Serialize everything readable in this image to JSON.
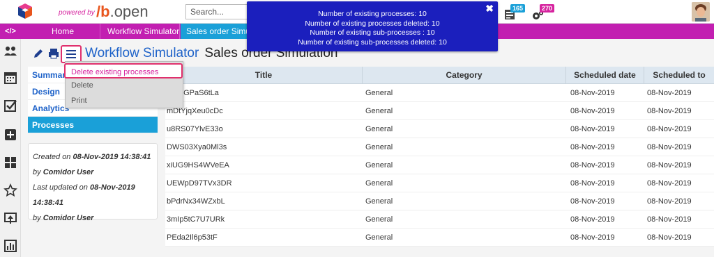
{
  "topbar": {
    "powered_by": "powered by",
    "brand_prefix": "b",
    "brand_suffix": ".open",
    "search_placeholder": "Search...",
    "badges": [
      {
        "name": "tasks-icon",
        "count": "165",
        "color": "#1aa0d8"
      },
      {
        "name": "gear-icon",
        "count": "270",
        "color": "#d6249f"
      }
    ]
  },
  "nav": {
    "code_icon": "</>",
    "items": [
      {
        "label": "Home"
      },
      {
        "label": "Workflow Simulator"
      },
      {
        "label": "Sales order Simulation"
      }
    ]
  },
  "header": {
    "app_title": "Workflow Simulator",
    "page_title": "Sales order Simulation"
  },
  "dropdown": {
    "items": [
      "Delete existing processes",
      "Delete",
      "Print"
    ]
  },
  "tabs": [
    "Summary",
    "Design",
    "Analytics",
    "Processes"
  ],
  "info": {
    "created_label": "Created on",
    "created_value": "08-Nov-2019 14:38:41",
    "by_label": "by",
    "created_by": "Comidor User",
    "updated_label": "Last updated on",
    "updated_value": "08-Nov-2019 14:38:41",
    "updated_by": "Comidor User"
  },
  "table": {
    "columns": [
      "Title",
      "Category",
      "Scheduled date",
      "Scheduled to"
    ],
    "rows": [
      [
        "3GPaS6tLa",
        "General",
        "08-Nov-2019",
        "08-Nov-2019"
      ],
      [
        "mDtYjqXeu0cDc",
        "General",
        "08-Nov-2019",
        "08-Nov-2019"
      ],
      [
        "u8RS07YlvE33o",
        "General",
        "08-Nov-2019",
        "08-Nov-2019"
      ],
      [
        "DWS03Xya0Ml3s",
        "General",
        "08-Nov-2019",
        "08-Nov-2019"
      ],
      [
        "xiUG9HS4WVeEA",
        "General",
        "08-Nov-2019",
        "08-Nov-2019"
      ],
      [
        "UEWpD97TVx3DR",
        "General",
        "08-Nov-2019",
        "08-Nov-2019"
      ],
      [
        "bPdrNx34WZxbL",
        "General",
        "08-Nov-2019",
        "08-Nov-2019"
      ],
      [
        "3mIp5tC7U7URk",
        "General",
        "08-Nov-2019",
        "08-Nov-2019"
      ],
      [
        "PEda2Il6p53tF",
        "General",
        "08-Nov-2019",
        "08-Nov-2019"
      ]
    ]
  },
  "notification": {
    "lines": [
      "Number of existing processes: 10",
      "Number of existing processes deleted: 10",
      "Number of existing sub-processes : 10",
      "Number of existing sub-processes deleted: 10"
    ],
    "close_symbol": "✖"
  }
}
